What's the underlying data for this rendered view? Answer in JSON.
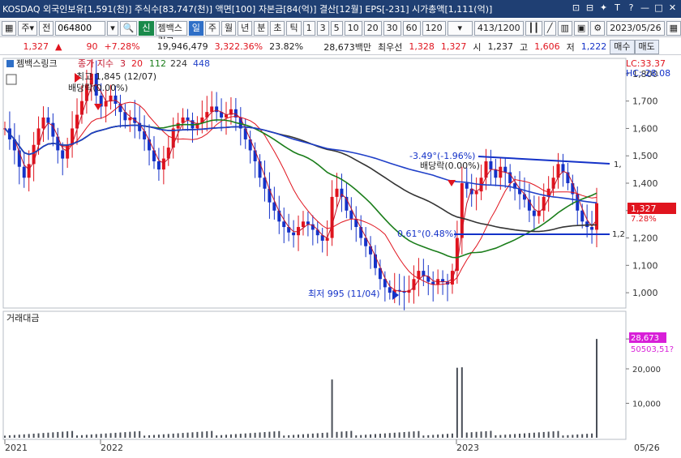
{
  "topbar": {
    "title": "KOSDAQ 외국인보유[1,591(천)] 주식수[83,747(천)] 액면[100] 자본금[84(억)] 결산[12월] EPS[-231] 시가총액[1,111(억)]"
  },
  "toolbar": {
    "market_select": "주",
    "prev_label": "전",
    "code_value": "064800",
    "new_label": "신",
    "stock_name": "젬백스링크",
    "periods": [
      "일",
      "주",
      "월",
      "년",
      "분",
      "초",
      "틱"
    ],
    "active_period": "일",
    "intervals": [
      "1",
      "3",
      "5",
      "10",
      "20",
      "30",
      "60",
      "120"
    ],
    "count": "413/1200",
    "date": "2023/05/26"
  },
  "infobar": {
    "price": "1,327",
    "change": "90",
    "change_pct": "+7.28%",
    "volume": "19,946,479",
    "volume_pct": "3,322.36%",
    "turnover_pct": "23.82%",
    "amount": "28,673백만",
    "best_ask_label": "최우선",
    "best_ask": "1,328",
    "best_bid": "1,327",
    "open_label": "시",
    "open": "1,237",
    "high_label": "고",
    "high": "1,606",
    "low_label": "저",
    "low": "1,222",
    "buy_label": "매수",
    "sell_label": "매도"
  },
  "chart_data": {
    "type": "line",
    "title": "젬백스링크",
    "legend_prefix": "종가 지수",
    "ma_periods": [
      "3",
      "20",
      "112",
      "224",
      "448"
    ],
    "ma_colors": [
      "#c2142a",
      "#e0141e",
      "#1a7d1a",
      "#333333",
      "#1f3fc8"
    ],
    "ylim": [
      950,
      1850
    ],
    "yticks": [
      "1,800",
      "1,700",
      "1,600",
      "1,500",
      "1,400",
      "1,300",
      "1,200",
      "1,100",
      "1,000"
    ],
    "xlabels": [
      "2021",
      "2022",
      "2023"
    ],
    "x_end_label": "05/26",
    "lc_label": "LC:33.37",
    "hc_label": "HC:-28.08",
    "last_price": "1,327",
    "last_pct": "7.28%",
    "annotations": {
      "high": "최고 1,845 (12/07)",
      "low": "최저 995 (11/04)",
      "dividend1": "배당락(0.00%)",
      "dividend2": "배당락(0.00%)",
      "trend_top": "-3.49°(-1.96%)",
      "trend_bottom": "0.61°(0.48%)",
      "trend_top_end": "1,",
      "trend_bottom_end": "1,2"
    },
    "price_series": [
      1600,
      1560,
      1520,
      1460,
      1420,
      1470,
      1540,
      1600,
      1640,
      1620,
      1570,
      1520,
      1490,
      1540,
      1600,
      1650,
      1700,
      1760,
      1800,
      1720,
      1680,
      1700,
      1720,
      1690,
      1660,
      1630,
      1640,
      1620,
      1590,
      1560,
      1520,
      1480,
      1450,
      1490,
      1530,
      1600,
      1620,
      1640,
      1630,
      1600,
      1620,
      1640,
      1660,
      1680,
      1660,
      1640,
      1650,
      1670,
      1640,
      1600,
      1560,
      1520,
      1480,
      1420,
      1380,
      1330,
      1300,
      1260,
      1240,
      1220,
      1210,
      1240,
      1260,
      1250,
      1230,
      1210,
      1190,
      1200,
      1350,
      1380,
      1350,
      1300,
      1270,
      1240,
      1200,
      1170,
      1140,
      1090,
      1050,
      1020,
      1000,
      1010,
      1005,
      1000,
      1010,
      1050,
      1080,
      1060,
      1040,
      1030,
      1050,
      1040,
      1030,
      1080,
      1200,
      1400,
      1380,
      1360,
      1370,
      1420,
      1480,
      1450,
      1420,
      1460,
      1440,
      1400,
      1380,
      1360,
      1340,
      1300,
      1280,
      1300,
      1350,
      1380,
      1420,
      1470,
      1440,
      1400,
      1360,
      1300,
      1260,
      1240,
      1230,
      1327
    ],
    "volume_panel": {
      "title": "거래대금",
      "yticks": [
        "28,673",
        "20,000",
        "10,000"
      ],
      "ylim": [
        0,
        32000
      ],
      "last_value": "28,673",
      "ma_value": "50503,51?"
    }
  }
}
